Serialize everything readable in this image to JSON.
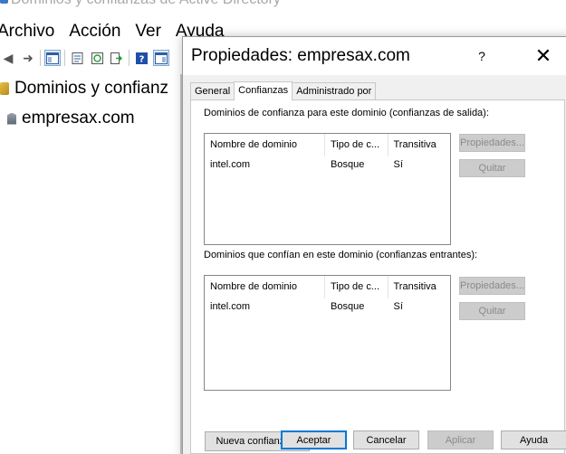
{
  "mmc": {
    "title": "Dominios y confianzas de Active Directory",
    "menu": [
      "Archivo",
      "Acción",
      "Ver",
      "Ayuda"
    ],
    "toolbar": [
      "back-arrow-icon",
      "forward-arrow-icon",
      "show-tree-icon",
      "properties-icon",
      "refresh-icon",
      "export-icon",
      "help-icon",
      "action-pane-icon"
    ],
    "tree": {
      "root_label": "Dominios y confianz",
      "child_label": "empresax.com"
    }
  },
  "dialog": {
    "title": "Propiedades: empresax.com",
    "help_label": "?",
    "close_label": "✕",
    "tabs": [
      {
        "label": "General",
        "selected": false
      },
      {
        "label": "Confianzas",
        "selected": true
      },
      {
        "label": "Administrado por",
        "selected": false
      }
    ],
    "outgoing": {
      "label": "Dominios de confianza para este dominio (confianzas de salida):",
      "columns": [
        "Nombre de dominio",
        "Tipo de c...",
        "Transitiva"
      ],
      "rows": [
        [
          "intel.com",
          "Bosque",
          "Sí"
        ]
      ],
      "properties_label": "Propiedades...",
      "remove_label": "Quitar"
    },
    "incoming": {
      "label": "Dominios que confían en este dominio (confianzas entrantes):",
      "columns": [
        "Nombre de dominio",
        "Tipo de c...",
        "Transitiva"
      ],
      "rows": [
        [
          "intel.com",
          "Bosque",
          "Sí"
        ]
      ],
      "properties_label": "Propiedades...",
      "remove_label": "Quitar"
    },
    "new_trust_label": "Nueva confianza...",
    "buttons": {
      "ok": "Aceptar",
      "cancel": "Cancelar",
      "apply": "Aplicar",
      "help": "Ayuda"
    }
  }
}
